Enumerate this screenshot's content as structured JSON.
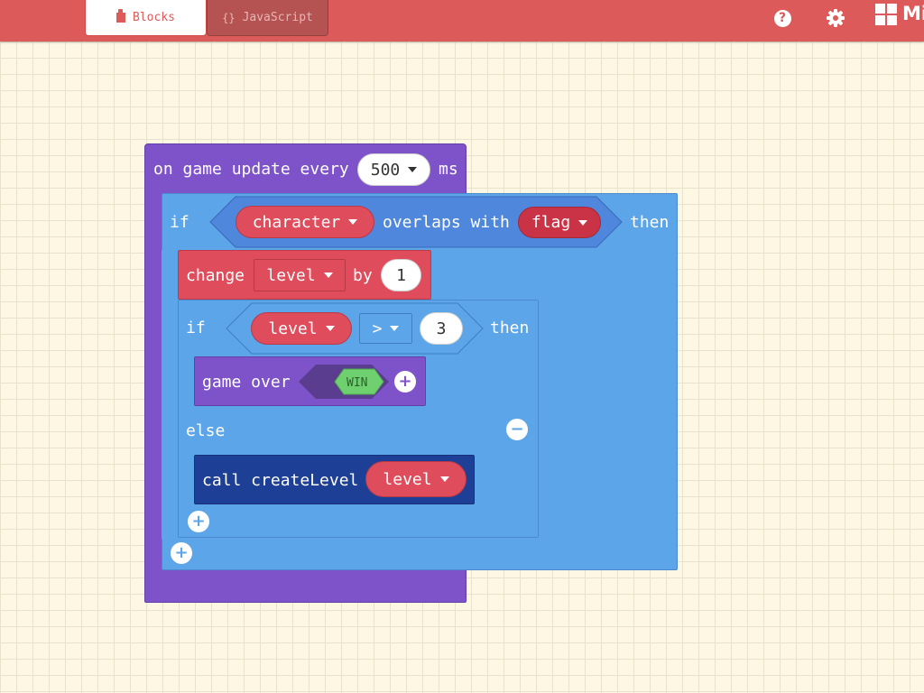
{
  "header": {
    "tabs": [
      {
        "label": "Blocks",
        "icon": "puzzle-icon",
        "active": true
      },
      {
        "label": "JavaScript",
        "icon": "braces-icon",
        "glyph": "{}",
        "active": false
      }
    ],
    "help_glyph": "?",
    "brand_text": "Mi",
    "colors": {
      "bar": "#dc5a5a",
      "tab_active_text": "#dc5a5a"
    }
  },
  "workspace": {
    "on_update": {
      "prefix": "on game update every",
      "interval": "500",
      "unit": "ms"
    },
    "if_overlap": {
      "if_label": "if",
      "sprite": "character",
      "overlaps_label": "overlaps with",
      "kind": "flag",
      "then_label": "then"
    },
    "change_level": {
      "change_label": "change",
      "variable": "level",
      "by_label": "by",
      "amount": "1"
    },
    "if_compare": {
      "if_label": "if",
      "variable": "level",
      "operator": ">",
      "value": "3",
      "then_label": "then"
    },
    "game_over": {
      "label": "game over",
      "result": "WIN",
      "add_glyph": "+"
    },
    "else_block": {
      "label": "else",
      "remove_glyph": "−"
    },
    "call_block": {
      "label": "call createLevel",
      "argument": "level"
    },
    "add_glyph": "+",
    "colors": {
      "events": "#7e52c9",
      "logic": "#5ca5e9",
      "variables": "#df4c5c",
      "functions": "#1e3f96",
      "boolean_win": "#6fd06f"
    }
  }
}
